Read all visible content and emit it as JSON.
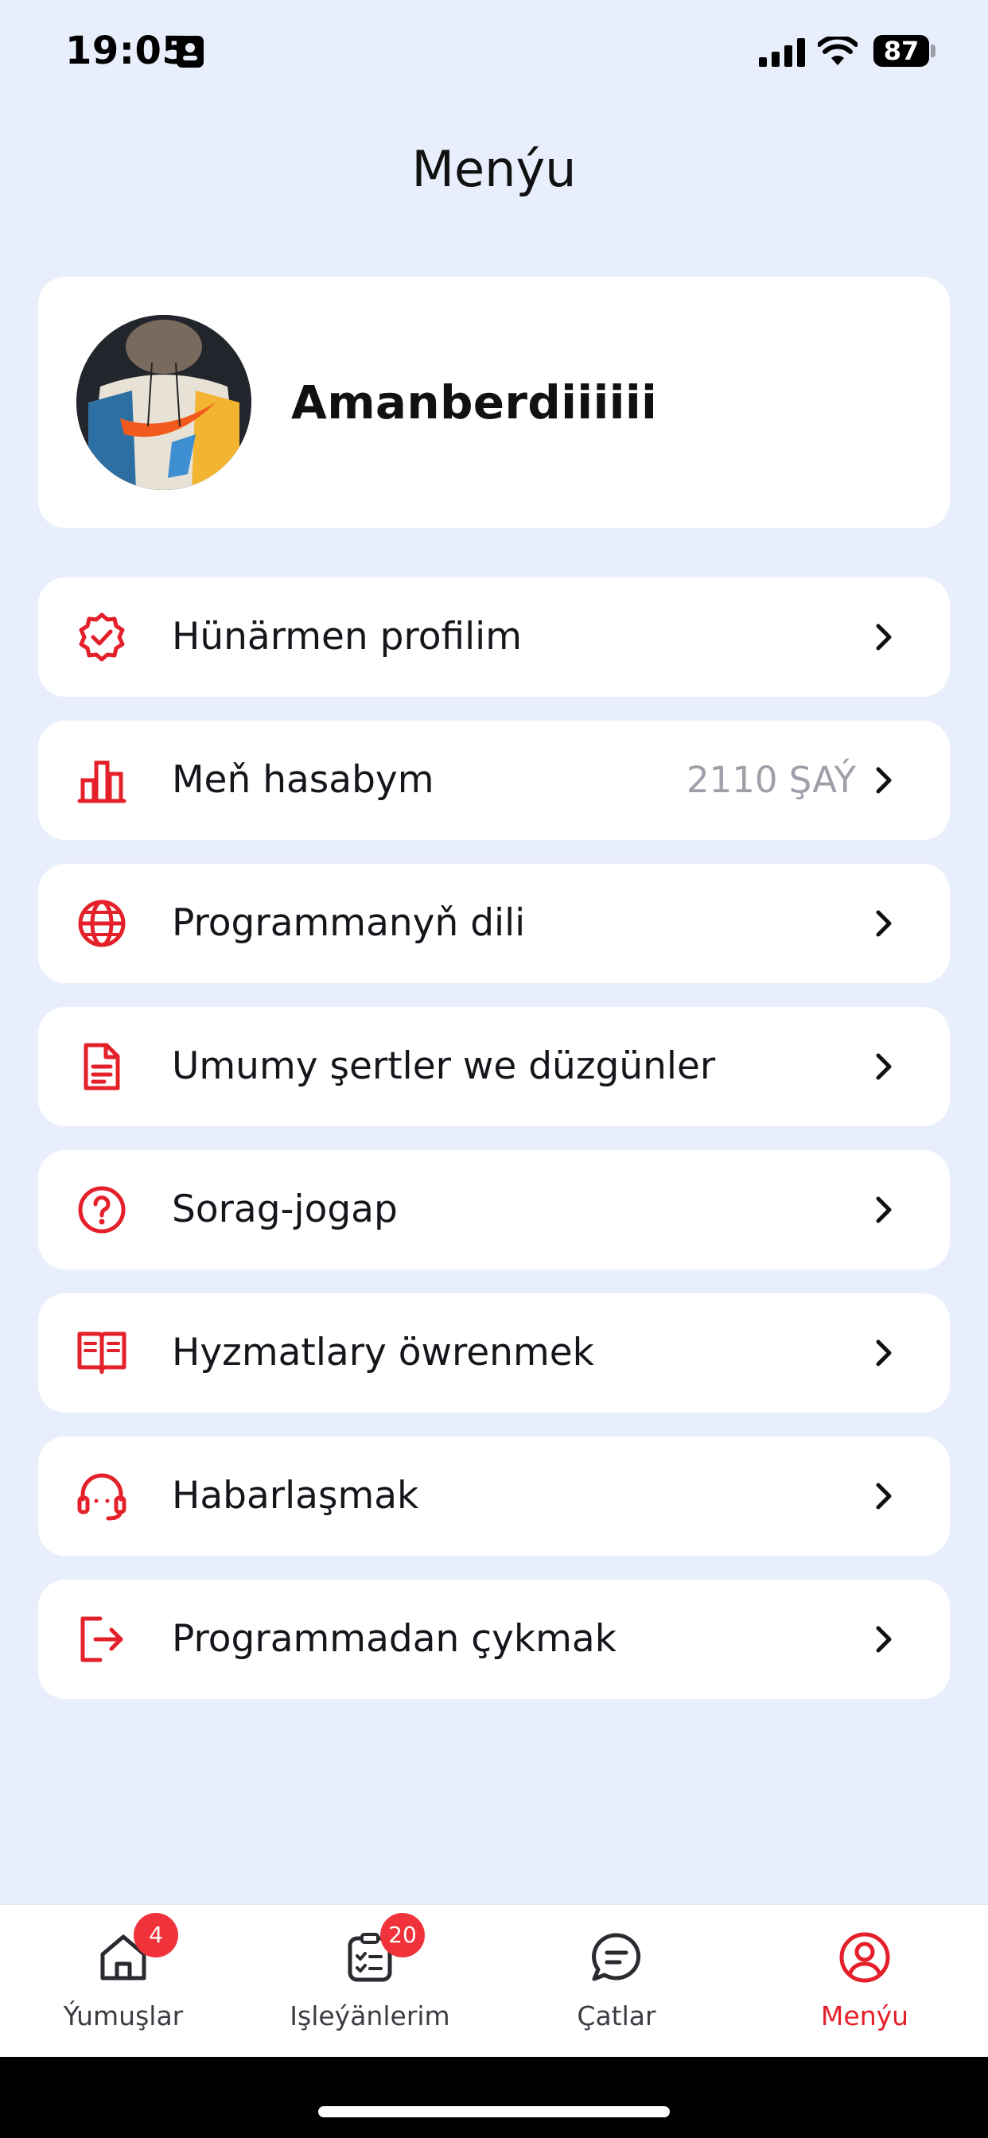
{
  "status_bar": {
    "time": "19:05",
    "battery": "87"
  },
  "page": {
    "title": "Menýu"
  },
  "profile": {
    "name": "Amanberdiiiiii"
  },
  "menu": {
    "items": [
      {
        "label": "Hünärmen profilim",
        "icon": "verified-badge-icon"
      },
      {
        "label": "Meň hasabym",
        "value": "2110 ŞAÝ",
        "icon": "bar-chart-icon"
      },
      {
        "label": "Programmanyň dili",
        "icon": "globe-icon"
      },
      {
        "label": "Umumy şertler we düzgünler",
        "icon": "document-icon"
      },
      {
        "label": "Sorag-jogap",
        "icon": "question-circle-icon"
      },
      {
        "label": "Hyzmatlary öwrenmek",
        "icon": "open-book-icon"
      },
      {
        "label": "Habarlaşmak",
        "icon": "headset-icon"
      },
      {
        "label": "Programmadan çykmak",
        "icon": "logout-icon"
      }
    ]
  },
  "tabs": [
    {
      "label": "Ýumuşlar",
      "badge": "4",
      "icon": "home-icon"
    },
    {
      "label": "Işleýänlerim",
      "badge": "20",
      "icon": "task-list-icon"
    },
    {
      "label": "Çatlar",
      "icon": "chat-icon"
    },
    {
      "label": "Menýu",
      "icon": "user-circle-icon",
      "active": true
    }
  ],
  "colors": {
    "accent": "#E4202A",
    "background": "#E8EEFC",
    "card": "#FFFFFF",
    "badge": "#F0323A",
    "secondary_text": "#9DA0A8"
  }
}
